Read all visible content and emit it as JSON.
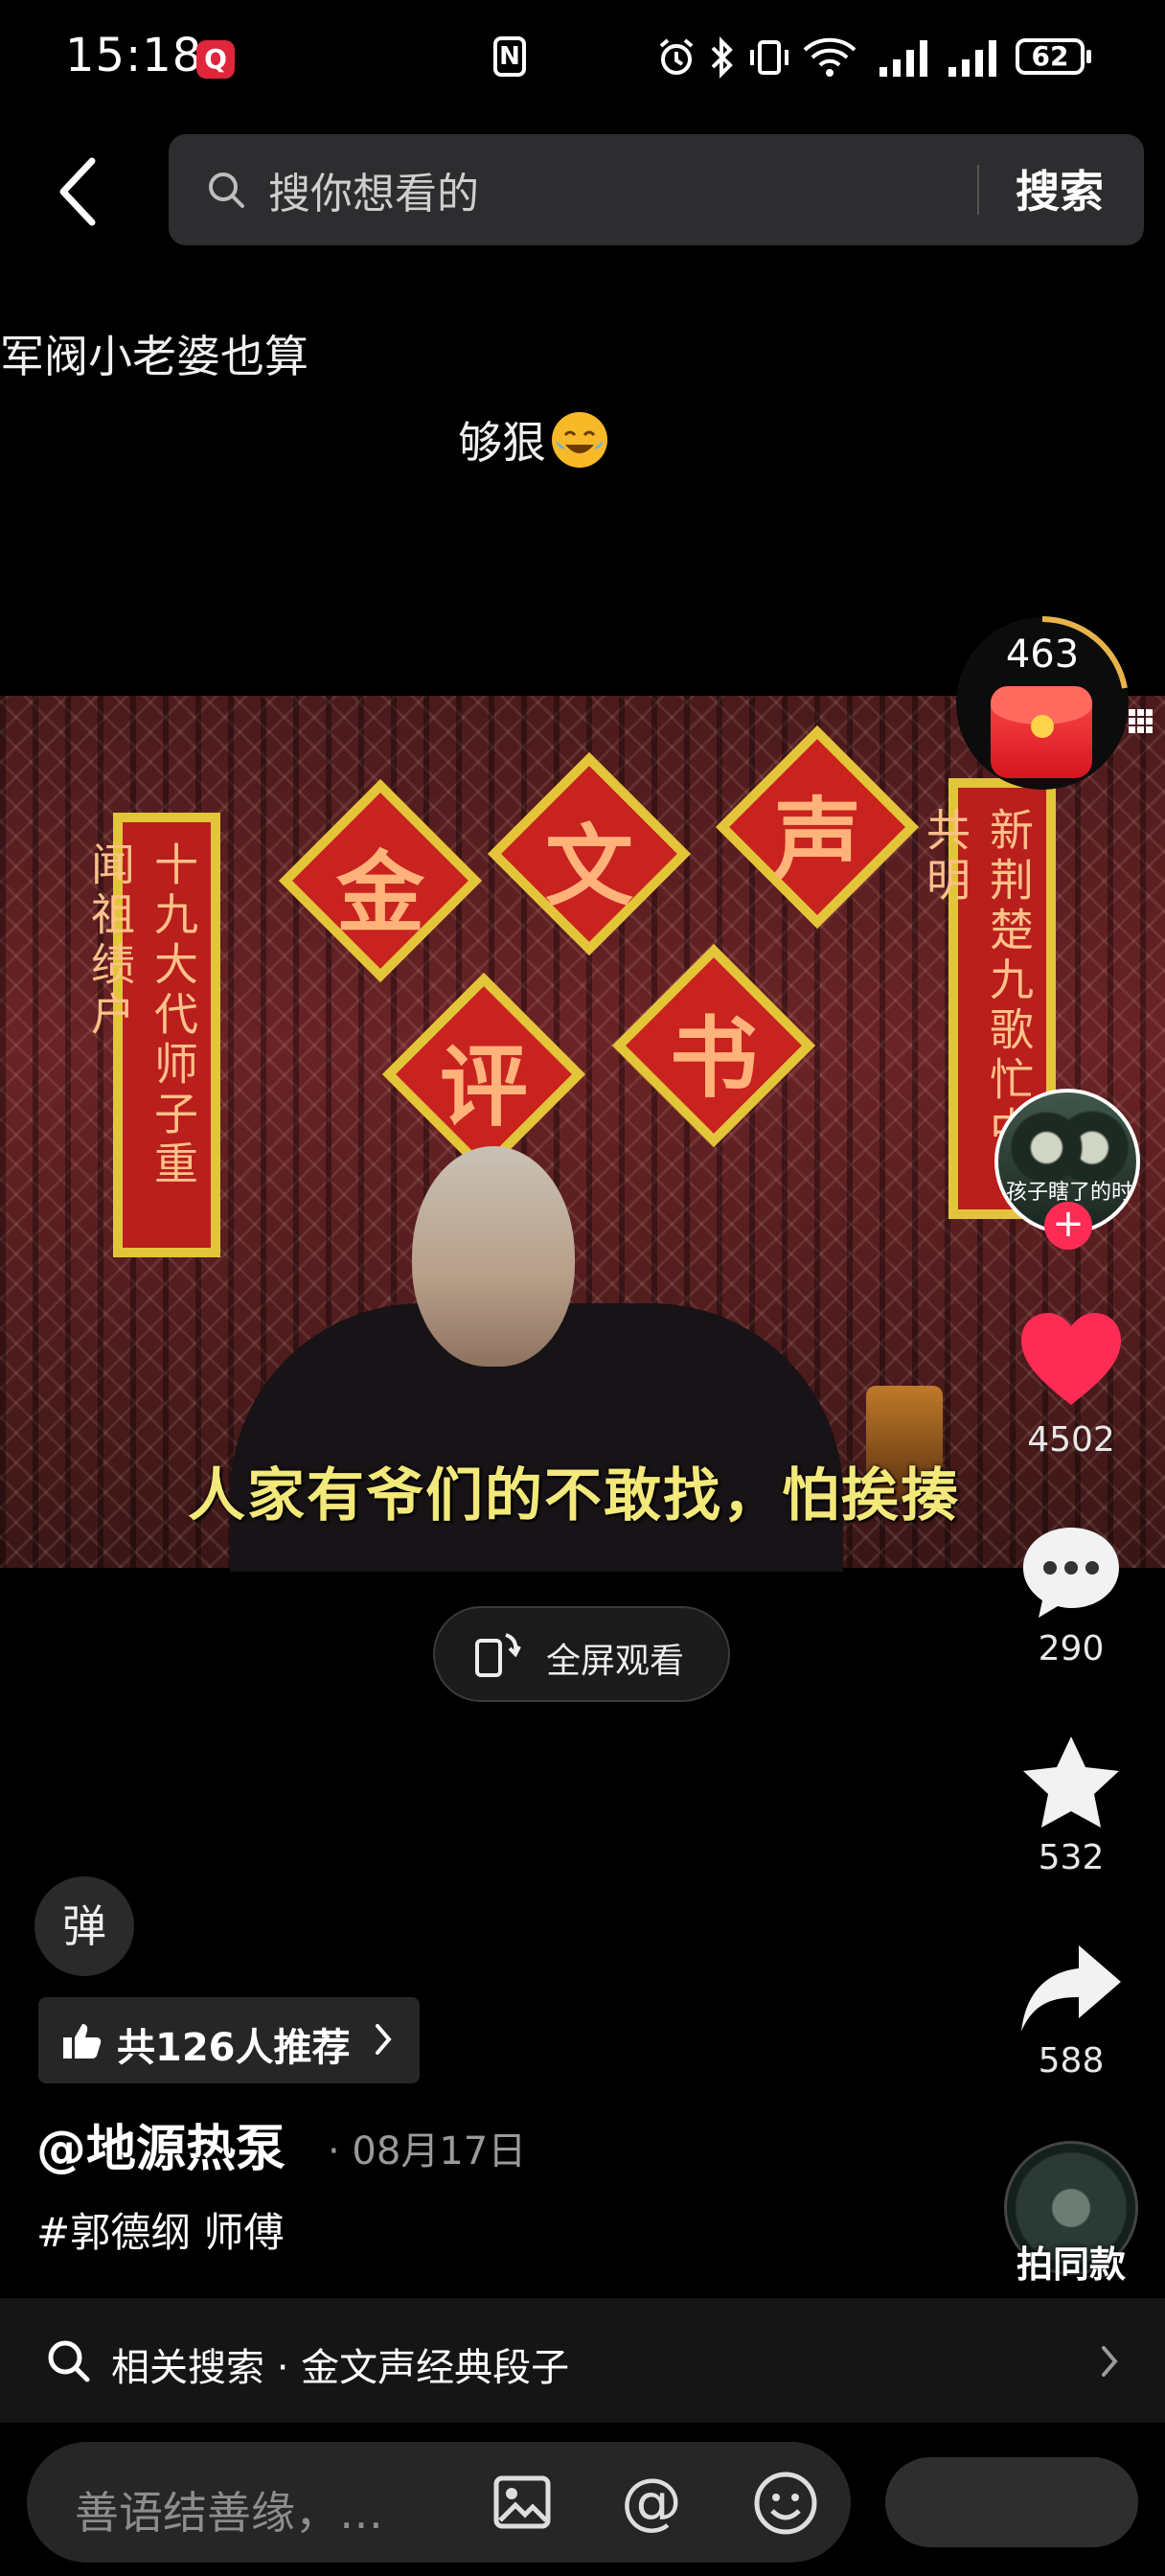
{
  "status_bar": {
    "time": "15:18",
    "app_badge": "Q",
    "nfc_label": "N",
    "battery": "62"
  },
  "search": {
    "placeholder": "搜你想看的",
    "button": "搜索"
  },
  "caption": {
    "line1": "军阀小老婆也算",
    "line2": "够狠"
  },
  "video": {
    "subtitle": "人家有爷们的不敢找，怕挨揍",
    "decor_chars": [
      "金",
      "文",
      "声",
      "评",
      "书"
    ],
    "banner_left": "十九大代师子重闻祖绩户",
    "banner_right": "新荆楚九歌忙中共明"
  },
  "fullscreen": {
    "label": "全屏观看"
  },
  "right_rail": {
    "reward_count": "463",
    "avatar_text": "孩子瞎了的时候",
    "likes": "4502",
    "comments": "290",
    "favorites": "532",
    "shares": "588",
    "same_style_label": "拍同款"
  },
  "post": {
    "danmaku_label": "弹",
    "recommend_label": "共126人推荐",
    "author": "@地源热泵",
    "date": "· 08月17日",
    "hashtags": "#郭德纲 师傅"
  },
  "related_search": {
    "label": "相关搜索 · 金文声经典段子"
  },
  "comment_bar": {
    "placeholder": "善语结善缘，…"
  },
  "colors": {
    "background": "#000000",
    "like_red": "#fe2c55",
    "subtitle_yellow": "#f3e87a",
    "reward_red": "#e0263b"
  },
  "icons": [
    "back-icon",
    "search-icon",
    "alarm-icon",
    "bluetooth-icon",
    "vibrate-icon",
    "wifi-icon",
    "signal-icon",
    "heart-icon",
    "comment-icon",
    "star-icon",
    "share-icon",
    "image-icon",
    "at-icon",
    "emoji-icon",
    "thumbs-up-icon",
    "chevron-right-icon"
  ]
}
